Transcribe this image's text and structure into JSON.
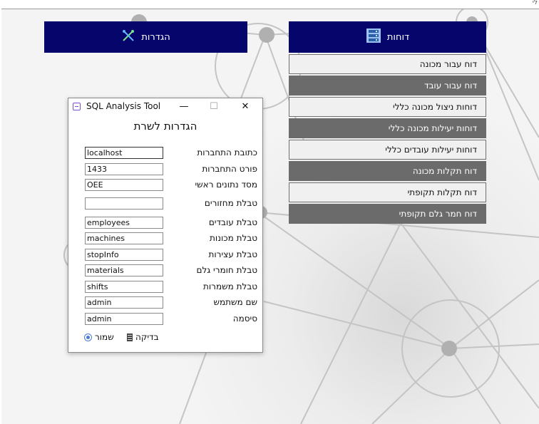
{
  "top_bar": {
    "text": "לי"
  },
  "buttons": {
    "settings": "הגדרות",
    "reports": "דוחות"
  },
  "reports_menu": [
    {
      "label": "דוח עבור מכונה",
      "style": "light"
    },
    {
      "label": "דוח עבור עובד",
      "style": "dark"
    },
    {
      "label": "דוחות ניצול מכונה כללי",
      "style": "light"
    },
    {
      "label": "דוחות יעילות מכונה כללי",
      "style": "dark"
    },
    {
      "label": "דוחות יעילות עובדים כללי",
      "style": "light"
    },
    {
      "label": "דוח תקלות מכונה",
      "style": "dark"
    },
    {
      "label": "דוח תקלות תקופתי",
      "style": "light"
    },
    {
      "label": "דוח חמר גלם תקופתי",
      "style": "dark"
    }
  ],
  "dialog": {
    "window_title": "SQL Analysis Tool",
    "window_controls": {
      "minimize": "—",
      "maximize": "☐",
      "close": "✕"
    },
    "heading": "הגדרות לשרת",
    "fields": [
      {
        "label": "כתובת התחברות",
        "value": "localhost"
      },
      {
        "label": "פורט התחברות",
        "value": "1433"
      },
      {
        "label": "מסד נתונים ראשי",
        "value": "OEE"
      },
      {
        "label": "טבלת מחזורים",
        "value": ""
      },
      {
        "label": "טבלת עובדים",
        "value": "employees"
      },
      {
        "label": "טבלת מכונות",
        "value": "machines"
      },
      {
        "label": "טבלת עצירות",
        "value": "stopInfo"
      },
      {
        "label": "טבלת חומרי גלם",
        "value": "materials"
      },
      {
        "label": "טבלת משמרות",
        "value": "shifts"
      },
      {
        "label": "שם משתמש",
        "value": "admin"
      },
      {
        "label": "סיסמה",
        "value": "admin"
      }
    ],
    "test_button": "בדיקה",
    "save_button": "שמור"
  },
  "colors": {
    "header_bg": "#05056b",
    "menu_dark": "#6b6b6b",
    "menu_light": "#f0f0f0"
  },
  "icons": {
    "settings": "crossed-tools-icon",
    "reports": "server-stack-icon",
    "save": "radio-dot-icon",
    "test": "document-icon"
  }
}
